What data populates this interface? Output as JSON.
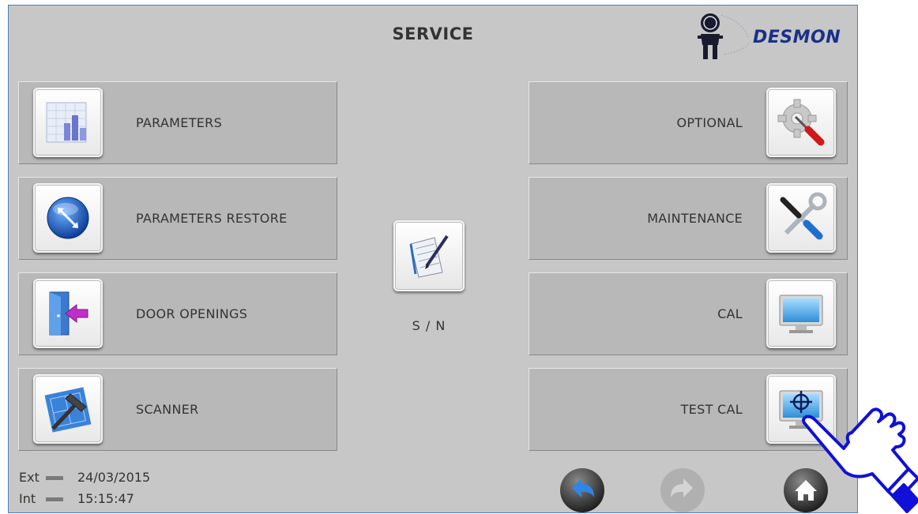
{
  "header": {
    "title": "SERVICE",
    "logo_text": "DESMON"
  },
  "left_buttons": [
    {
      "label": "PARAMETERS",
      "icon": "bar-chart-document-icon"
    },
    {
      "label": "PARAMETERS RESTORE",
      "icon": "blue-globe-arrow-icon"
    },
    {
      "label": "DOOR OPENINGS",
      "icon": "door-arrow-icon"
    },
    {
      "label": "SCANNER",
      "icon": "hammer-blueprint-icon"
    }
  ],
  "right_buttons": [
    {
      "label": "OPTIONAL",
      "icon": "gear-screwdriver-icon"
    },
    {
      "label": "MAINTENANCE",
      "icon": "wrench-screwdriver-icon"
    },
    {
      "label": "CAL",
      "icon": "monitor-icon"
    },
    {
      "label": "TEST CAL",
      "icon": "monitor-crosshair-icon"
    }
  ],
  "center": {
    "label": "S / N",
    "icon": "notebook-pen-icon"
  },
  "status": {
    "ext_label": "Ext",
    "int_label": "Int",
    "date": "24/03/2015",
    "time": "15:15:47"
  },
  "nav": {
    "back": "back-icon",
    "forward": "forward-icon",
    "home": "home-icon"
  },
  "colors": {
    "background": "#c7c7c7",
    "panel": "#b8b8b8",
    "brand": "#1b2f8a"
  }
}
